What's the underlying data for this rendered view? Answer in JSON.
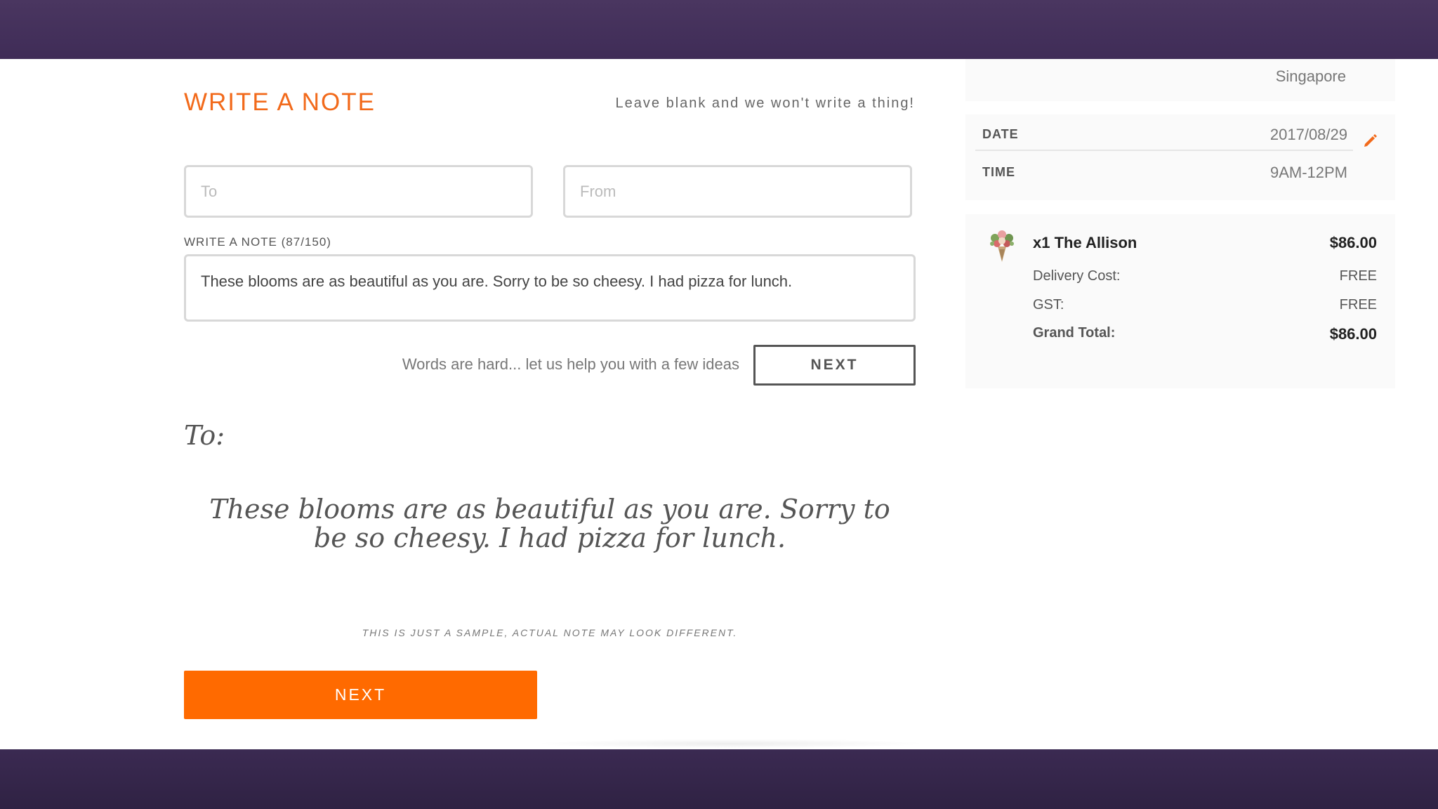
{
  "note": {
    "title": "WRITE A NOTE",
    "hint": "Leave blank and we won't write a thing!",
    "to_placeholder": "To",
    "from_placeholder": "From",
    "to_value": "",
    "from_value": "",
    "message_label": "WRITE A NOTE (87/150)",
    "message_value": "These blooms are as beautiful as you are. Sorry to be so cheesy. I had pizza for lunch.",
    "ideas_text": "Words are hard... let us help you with a few ideas",
    "ideas_button": "NEXT"
  },
  "preview": {
    "to_label": "To:",
    "message": "These blooms are as beautiful as you are. Sorry to be so cheesy. I had pizza for lunch.",
    "disclaimer": "THIS IS JUST A SAMPLE, ACTUAL NOTE MAY LOOK DIFFERENT."
  },
  "primary_button": "NEXT",
  "summary": {
    "location": "Singapore",
    "date_label": "DATE",
    "date_value": "2017/08/29",
    "time_label": "TIME",
    "time_value": "9AM-12PM",
    "edit_icon": "pencil-icon",
    "item_name": "x1 The Allison",
    "item_price": "$86.00",
    "item_icon": "flower-bouquet-icon",
    "delivery_label": "Delivery Cost:",
    "delivery_value": "FREE",
    "gst_label": "GST:",
    "gst_value": "FREE",
    "total_label": "Grand Total:",
    "total_value": "$86.00"
  },
  "colors": {
    "accent": "#f26a1b",
    "button": "#ff6a00",
    "frame": "#3d2d55"
  }
}
